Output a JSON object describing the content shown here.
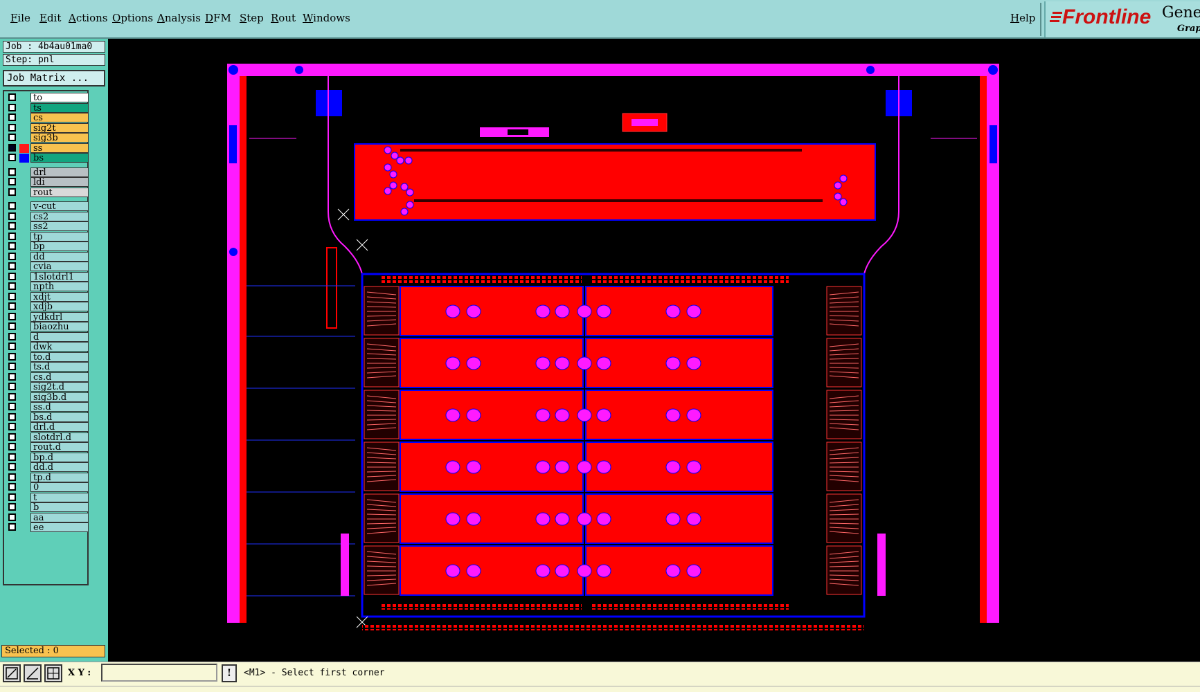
{
  "menu": {
    "items": [
      "File",
      "Edit",
      "Actions",
      "Options",
      "Analysis",
      "DFM",
      "Step",
      "Rout",
      "Windows"
    ],
    "help": "Help"
  },
  "logo": {
    "brand": "Frontline",
    "product": "Genes",
    "sub": "Grapi"
  },
  "job": {
    "label": "Job : 4b4au01ma0",
    "step": "Step: pnl",
    "matrix_button": "Job Matrix ..."
  },
  "layers": [
    {
      "name": "to",
      "color": "#ffffff",
      "swatch": "#5fcfb8",
      "checked": false
    },
    {
      "name": "ts",
      "color": "#12a57f",
      "swatch": "#5fcfb8",
      "checked": false
    },
    {
      "name": "cs",
      "color": "#f8c24f",
      "swatch": "#5fcfb8",
      "checked": false
    },
    {
      "name": "sig2t",
      "color": "#f8c24f",
      "swatch": "#5fcfb8",
      "checked": false
    },
    {
      "name": "sig3b",
      "color": "#f8c24f",
      "swatch": "#5fcfb8",
      "checked": false
    },
    {
      "name": "ss",
      "color": "#f8c24f",
      "swatch": "#ff1a1a",
      "checked": true
    },
    {
      "name": "bs",
      "color": "#12a57f",
      "swatch": "#0000ff",
      "checked": false
    },
    {
      "name": "drl",
      "color": "#b8c0c4",
      "swatch": "#5fcfb8",
      "checked": false
    },
    {
      "name": "ldi",
      "color": "#b8c0c4",
      "swatch": "#5fcfb8",
      "checked": false
    },
    {
      "name": "rout",
      "color": "#d9d9d9",
      "swatch": "#5fcfb8",
      "checked": false
    },
    {
      "name": "v-cut",
      "color": "#9fd9d8",
      "swatch": "#5fcfb8",
      "checked": false
    },
    {
      "name": "cs2",
      "color": "#9fd9d8",
      "swatch": "#5fcfb8",
      "checked": false
    },
    {
      "name": "ss2",
      "color": "#9fd9d8",
      "swatch": "#5fcfb8",
      "checked": false
    },
    {
      "name": "tp",
      "color": "#9fd9d8",
      "swatch": "#5fcfb8",
      "checked": false
    },
    {
      "name": "bp",
      "color": "#9fd9d8",
      "swatch": "#5fcfb8",
      "checked": false
    },
    {
      "name": "dd",
      "color": "#9fd9d8",
      "swatch": "#5fcfb8",
      "checked": false
    },
    {
      "name": "cvia",
      "color": "#9fd9d8",
      "swatch": "#5fcfb8",
      "checked": false
    },
    {
      "name": "1slotdrl1",
      "color": "#9fd9d8",
      "swatch": "#5fcfb8",
      "checked": false
    },
    {
      "name": "npth",
      "color": "#9fd9d8",
      "swatch": "#5fcfb8",
      "checked": false
    },
    {
      "name": "xdjt",
      "color": "#9fd9d8",
      "swatch": "#5fcfb8",
      "checked": false
    },
    {
      "name": "xdjb",
      "color": "#9fd9d8",
      "swatch": "#5fcfb8",
      "checked": false
    },
    {
      "name": "ydkdrl",
      "color": "#9fd9d8",
      "swatch": "#5fcfb8",
      "checked": false
    },
    {
      "name": "biaozhu",
      "color": "#9fd9d8",
      "swatch": "#5fcfb8",
      "checked": false
    },
    {
      "name": "d",
      "color": "#9fd9d8",
      "swatch": "#5fcfb8",
      "checked": false
    },
    {
      "name": "dwk",
      "color": "#9fd9d8",
      "swatch": "#5fcfb8",
      "checked": false
    },
    {
      "name": "to.d",
      "color": "#9fd9d8",
      "swatch": "#5fcfb8",
      "checked": false
    },
    {
      "name": "ts.d",
      "color": "#9fd9d8",
      "swatch": "#5fcfb8",
      "checked": false
    },
    {
      "name": "cs.d",
      "color": "#9fd9d8",
      "swatch": "#5fcfb8",
      "checked": false
    },
    {
      "name": "sig2t.d",
      "color": "#9fd9d8",
      "swatch": "#5fcfb8",
      "checked": false
    },
    {
      "name": "sig3b.d",
      "color": "#9fd9d8",
      "swatch": "#5fcfb8",
      "checked": false
    },
    {
      "name": "ss.d",
      "color": "#9fd9d8",
      "swatch": "#5fcfb8",
      "checked": false
    },
    {
      "name": "bs.d",
      "color": "#9fd9d8",
      "swatch": "#5fcfb8",
      "checked": false
    },
    {
      "name": "drl.d",
      "color": "#9fd9d8",
      "swatch": "#5fcfb8",
      "checked": false
    },
    {
      "name": "slotdrl.d",
      "color": "#9fd9d8",
      "swatch": "#5fcfb8",
      "checked": false
    },
    {
      "name": "rout.d",
      "color": "#9fd9d8",
      "swatch": "#5fcfb8",
      "checked": false
    },
    {
      "name": "bp.d",
      "color": "#9fd9d8",
      "swatch": "#5fcfb8",
      "checked": false
    },
    {
      "name": "dd.d",
      "color": "#9fd9d8",
      "swatch": "#5fcfb8",
      "checked": false
    },
    {
      "name": "tp.d",
      "color": "#9fd9d8",
      "swatch": "#5fcfb8",
      "checked": false
    },
    {
      "name": "0",
      "color": "#9fd9d8",
      "swatch": "#5fcfb8",
      "checked": false
    },
    {
      "name": "t",
      "color": "#9fd9d8",
      "swatch": "#5fcfb8",
      "checked": false
    },
    {
      "name": "b",
      "color": "#9fd9d8",
      "swatch": "#5fcfb8",
      "checked": false
    },
    {
      "name": "aa",
      "color": "#9fd9d8",
      "swatch": "#5fcfb8",
      "checked": false
    },
    {
      "name": "ee",
      "color": "#9fd9d8",
      "swatch": "#5fcfb8",
      "checked": false
    }
  ],
  "selected": "Selected : 0",
  "status": {
    "xy_label": "X Y :",
    "xy_value": "",
    "exclaim": "!",
    "prompt": "<M1> - Select first corner"
  },
  "colors": {
    "magenta": "#ff1aff",
    "copper": "#ff0000",
    "blue": "#0000ff",
    "menu_bg": "#9fd9d8",
    "panel_bg": "#5fcfb8"
  }
}
